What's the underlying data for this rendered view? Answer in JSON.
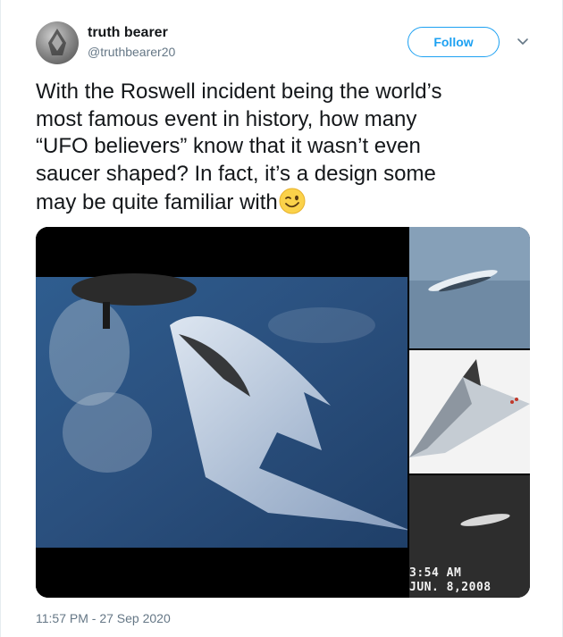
{
  "author": {
    "name": "truth bearer",
    "handle": "@truthbearer20"
  },
  "follow_label": "Follow",
  "tweet": {
    "lines": [
      "With the Roswell incident being the world’s",
      "most famous event in history, how many",
      "“UFO believers” know that it wasn’t even",
      "saucer shaped? In fact, it’s a design some",
      "may be quite familiar with"
    ],
    "emoji": "winking-face"
  },
  "media": {
    "overlay_time": "3:54 AM",
    "overlay_date": "JUN. 8,2008"
  },
  "timestamp": "11:57 PM - 27 Sep 2020",
  "colors": {
    "accent": "#1da1f2",
    "secondary_text": "#657786",
    "text": "#14171a"
  }
}
